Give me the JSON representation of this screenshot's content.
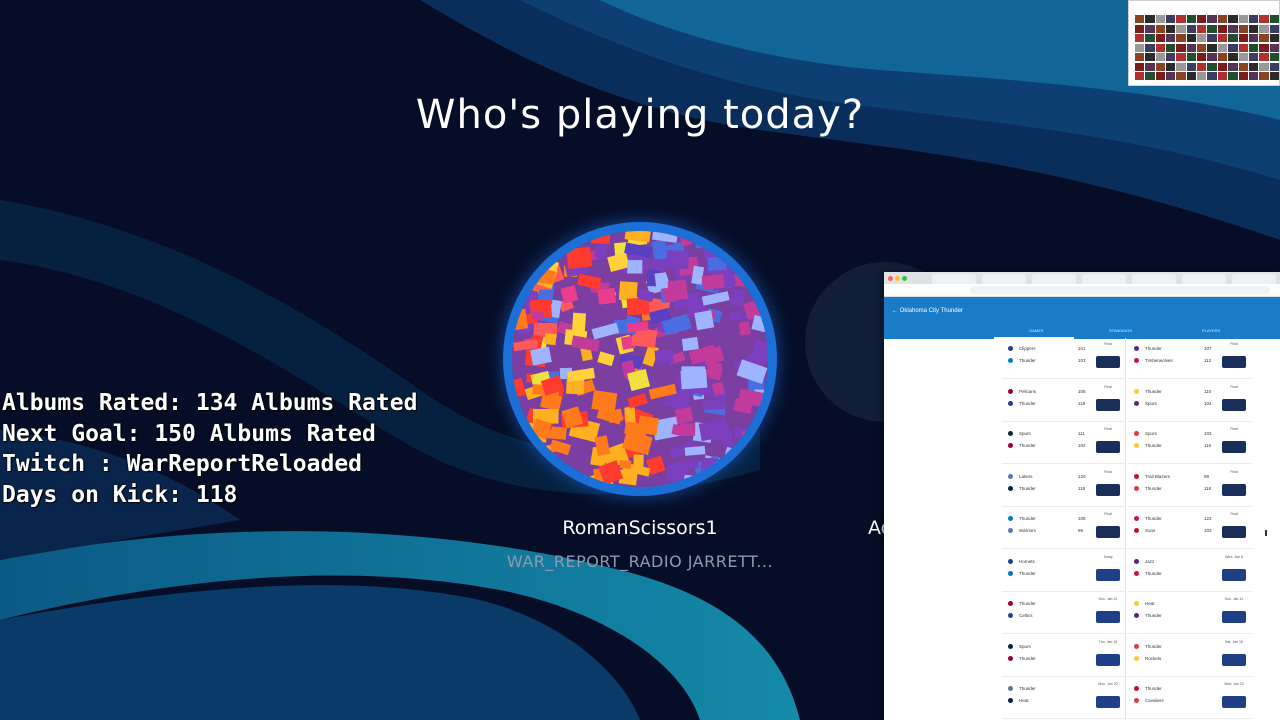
{
  "screen": {
    "heading": "Who's playing today?"
  },
  "stats_overlay": {
    "lines": [
      "Albums Rated: 134 Albums Rated",
      "Next Goal: 150 Albums Rated",
      "Twitch : WarReportReloaded",
      "Days on Kick: 118"
    ]
  },
  "profiles": [
    {
      "name": "RomanScissors1",
      "gamertag": "WAR_REPORT_RADIO JARRETT..."
    },
    {
      "name": "Ac"
    }
  ],
  "browser": {
    "header_title": "← Oklahoma City Thunder",
    "tabs": [
      "GAMES",
      "STANDINGS",
      "PLAYERS"
    ],
    "games": [
      {
        "t1": "Clippers",
        "s1": "101",
        "t2": "Thunder",
        "s2": "103",
        "status": "Final"
      },
      {
        "t1": "Thunder",
        "s1": "107",
        "t2": "Timberwolves",
        "s2": "112",
        "status": "Final"
      },
      {
        "t1": "Pelicans",
        "s1": "105",
        "t2": "Thunder",
        "s2": "118",
        "status": "Final"
      },
      {
        "t1": "Thunder",
        "s1": "110",
        "t2": "Spurs",
        "s2": "104",
        "status": "Final"
      },
      {
        "t1": "Spurs",
        "s1": "111",
        "t2": "Thunder",
        "s2": "102",
        "status": "Final"
      },
      {
        "t1": "Spurs",
        "s1": "103",
        "t2": "Thunder",
        "s2": "116",
        "status": "Final"
      },
      {
        "t1": "Lakers",
        "s1": "120",
        "t2": "Thunder",
        "s2": "116",
        "status": "Final"
      },
      {
        "t1": "Trail Blazers",
        "s1": "99",
        "t2": "Thunder",
        "s2": "118",
        "status": "Final"
      },
      {
        "t1": "Thunder",
        "s1": "105",
        "t2": "Warriors",
        "s2": "99",
        "status": "Final"
      },
      {
        "t1": "Thunder",
        "s1": "123",
        "t2": "Suns",
        "s2": "103",
        "status": "Final"
      },
      {
        "t1": "Hornets",
        "s1": "",
        "t2": "Thunder",
        "s2": "",
        "status": "Today"
      },
      {
        "t1": "Jazz",
        "s1": "",
        "t2": "Thunder",
        "s2": "",
        "status": "Wed, Jan 8"
      },
      {
        "t1": "Thunder",
        "s1": "",
        "t2": "Celtics",
        "s2": "",
        "status": "Sun, Jan 12"
      },
      {
        "t1": "Heat",
        "s1": "",
        "t2": "Thunder",
        "s2": "",
        "status": "Sun, Jan 12"
      },
      {
        "t1": "Spurs",
        "s1": "",
        "t2": "Thunder",
        "s2": "",
        "status": "Thu, Jan 16"
      },
      {
        "t1": "Thunder",
        "s1": "",
        "t2": "Rockets",
        "s2": "",
        "status": "Sat, Jan 18"
      },
      {
        "t1": "Thunder",
        "s1": "",
        "t2": "Heat",
        "s2": "",
        "status": "Mon, Jan 20"
      },
      {
        "t1": "Thunder",
        "s1": "",
        "t2": "Cavaliers",
        "s2": "",
        "status": "Wed, Jan 22"
      }
    ]
  },
  "colors": {
    "background": "#05102a",
    "ring": "#1d6fd8",
    "accent_blue": "#1a7bc9"
  }
}
